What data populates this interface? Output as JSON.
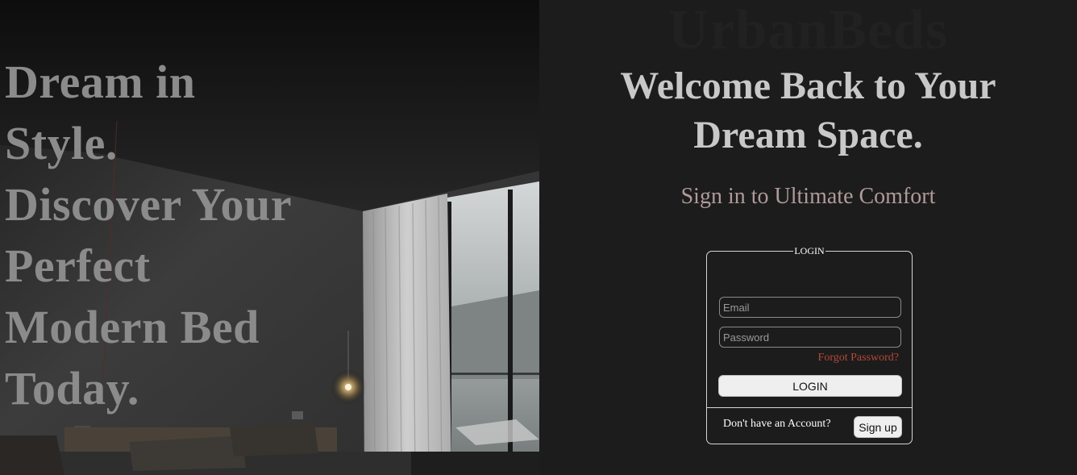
{
  "hero": {
    "tagline_lines": [
      "Dream in",
      "Style.",
      "Discover Your",
      "Perfect",
      "Modern Bed",
      "Today."
    ]
  },
  "brand": {
    "name": "UrbanBeds"
  },
  "welcome": {
    "lines": [
      "Welcome Back to Your",
      "Dream Space."
    ]
  },
  "subtitle": "Sign in to Ultimate Comfort",
  "login_form": {
    "legend": "LOGIN",
    "email_placeholder": "Email",
    "password_placeholder": "Password",
    "forgot_password": "Forgot Password?",
    "login_button": "LOGIN",
    "no_account_text": "Don't have an Account?",
    "signup_button": "Sign up"
  },
  "colors": {
    "background": "#1c1c1c",
    "heading": "#c8c8c8",
    "subtitle": "#b09a9a",
    "forgot_link": "#b5473a",
    "tagline": "#8b8b8b"
  }
}
